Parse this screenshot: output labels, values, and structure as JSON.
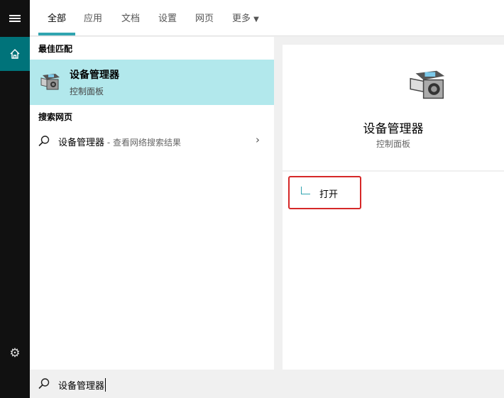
{
  "tabs": [
    {
      "label": "全部"
    },
    {
      "label": "应用"
    },
    {
      "label": "文档"
    },
    {
      "label": "设置"
    },
    {
      "label": "网页"
    },
    {
      "label": "更多"
    }
  ],
  "best_match": {
    "section": "最佳匹配",
    "title": "设备管理器",
    "subtitle": "控制面板"
  },
  "web": {
    "section": "搜索网页",
    "query": "设备管理器",
    "desc": " - 查看网络搜索结果"
  },
  "detail": {
    "title": "设备管理器",
    "subtitle": "控制面板",
    "open_label": "打开"
  },
  "search": {
    "value": "设备管理器"
  },
  "colors": {
    "accent": "#30a4b0",
    "selected": "#b2e8ec",
    "highlight": "#d62828"
  }
}
